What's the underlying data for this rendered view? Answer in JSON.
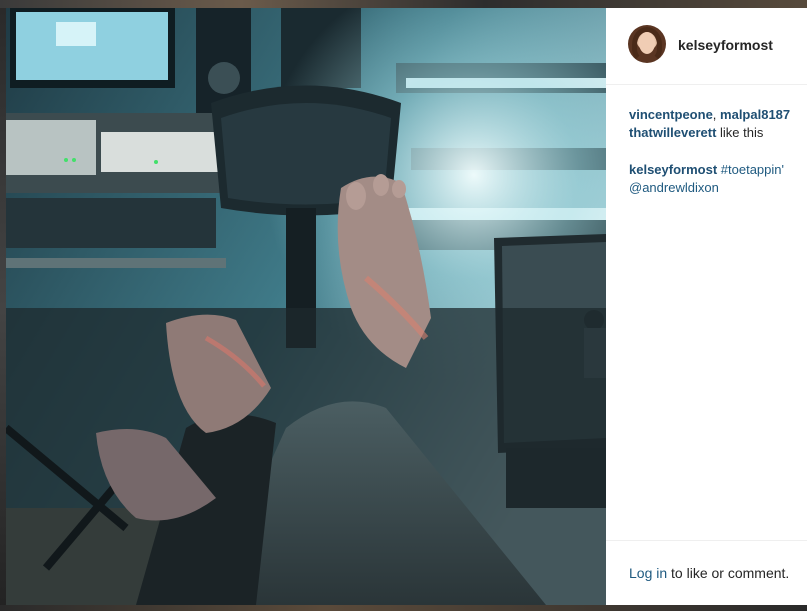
{
  "post": {
    "image_alt": "",
    "author": "kelseyformost",
    "likes": {
      "users": [
        "vincentpeone",
        "malpal8187",
        "thatwilleverett"
      ],
      "separator_1": ", ",
      "suffix": " like this"
    },
    "caption": {
      "user": "kelseyformost",
      "hashtag": "#toetappin'",
      "mention": "@andrewldixon"
    },
    "footer": {
      "login_link": "Log in",
      "text": " to like or comment."
    }
  },
  "colors": {
    "link": "#1f5a80",
    "text": "#262626",
    "media_tint": "#2a4c58"
  }
}
